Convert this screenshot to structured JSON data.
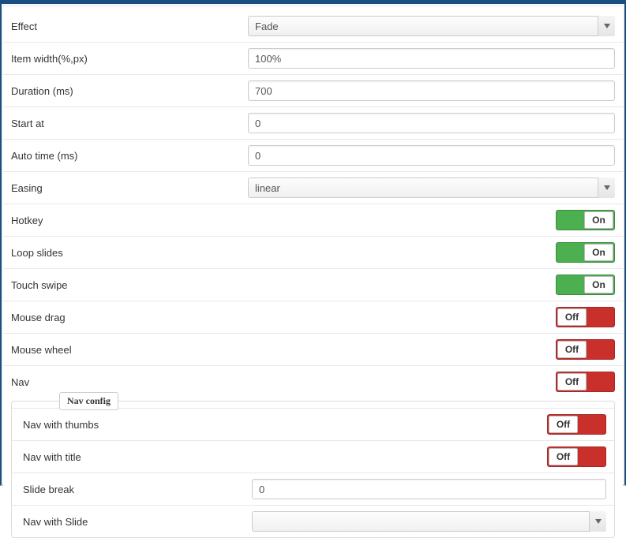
{
  "toggle_labels": {
    "on": "On",
    "off": "Off"
  },
  "select_placeholder_empty": "",
  "fields": {
    "effect": {
      "label": "Effect",
      "type": "select",
      "value": "Fade"
    },
    "item_width": {
      "label": "Item width(%,px)",
      "type": "text",
      "value": "100%"
    },
    "duration": {
      "label": "Duration (ms)",
      "type": "text",
      "value": "700"
    },
    "start_at": {
      "label": "Start at",
      "type": "text",
      "value": "0"
    },
    "auto_time": {
      "label": "Auto time (ms)",
      "type": "text",
      "value": "0"
    },
    "easing": {
      "label": "Easing",
      "type": "select",
      "value": "linear"
    },
    "hotkey": {
      "label": "Hotkey",
      "type": "toggle",
      "value": "on"
    },
    "loop_slides": {
      "label": "Loop slides",
      "type": "toggle",
      "value": "on"
    },
    "touch_swipe": {
      "label": "Touch swipe",
      "type": "toggle",
      "value": "on"
    },
    "mouse_drag": {
      "label": "Mouse drag",
      "type": "toggle",
      "value": "off"
    },
    "mouse_wheel": {
      "label": "Mouse wheel",
      "type": "toggle",
      "value": "off"
    },
    "nav": {
      "label": "Nav",
      "type": "toggle",
      "value": "off"
    }
  },
  "nav_config": {
    "legend": "Nav config",
    "fields": {
      "nav_thumbs": {
        "label": "Nav with thumbs",
        "type": "toggle",
        "value": "off"
      },
      "nav_title": {
        "label": "Nav with title",
        "type": "toggle",
        "value": "off"
      },
      "slide_break": {
        "label": "Slide break",
        "type": "text",
        "value": "0"
      },
      "nav_slide": {
        "label": "Nav with Slide",
        "type": "select",
        "value": ""
      }
    }
  }
}
